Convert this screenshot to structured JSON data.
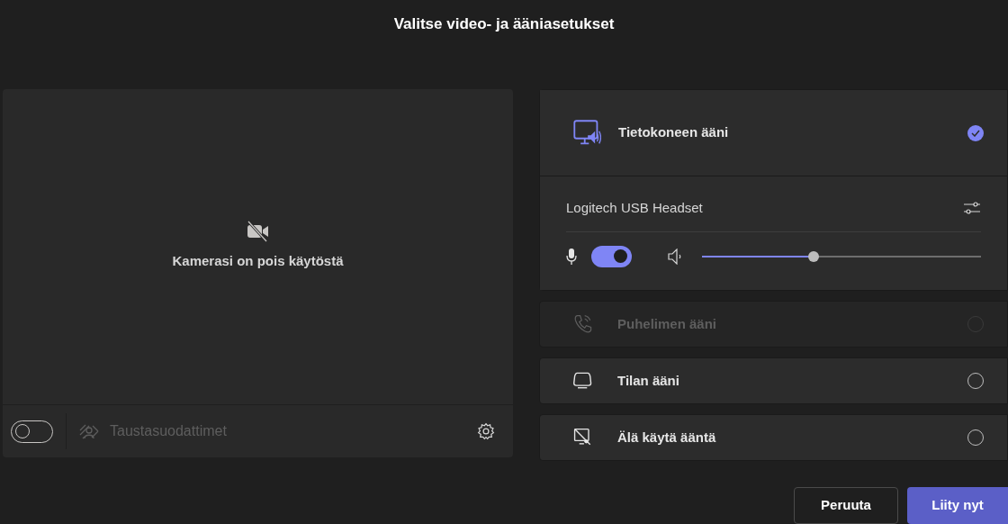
{
  "title": "Valitse video- ja ääniasetukset",
  "camera": {
    "message": "Kamerasi on pois käytöstä",
    "background_toggle": {
      "on": false
    },
    "background_filters": {
      "label": "Taustasuodattimet",
      "disabled": true
    }
  },
  "audio_options": [
    {
      "kind": "computer",
      "label": "Tietokoneen ääni",
      "selected": true,
      "disabled": false
    },
    {
      "kind": "phone",
      "label": "Puhelimen ääni",
      "selected": false,
      "disabled": true
    },
    {
      "kind": "room",
      "label": "Tilan ääni",
      "selected": false,
      "disabled": false
    },
    {
      "kind": "none",
      "label": "Älä käytä ääntä",
      "selected": false,
      "disabled": false
    }
  ],
  "device": {
    "name": "Logitech USB Headset",
    "mic_on": true,
    "volume": {
      "level": 0.4
    }
  },
  "buttons": [
    {
      "kind": "secondary",
      "label": "Peruuta"
    },
    {
      "kind": "primary",
      "label": "Liity nyt"
    }
  ]
}
